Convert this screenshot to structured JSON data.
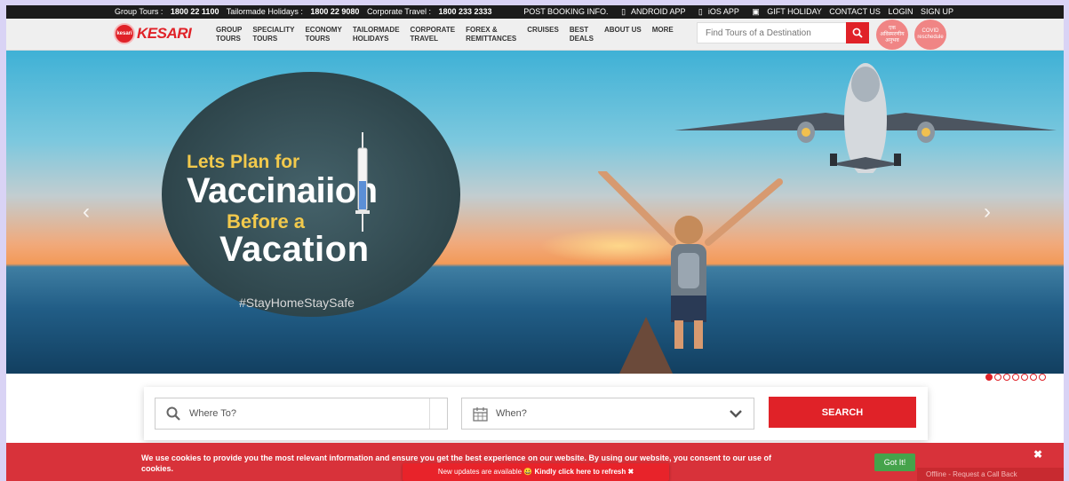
{
  "topbar": {
    "group_tours_label": "Group Tours :",
    "group_tours_phone": "1800 22 1100",
    "tailormade_label": "Tailormade Holidays :",
    "tailormade_phone": "1800 22 9080",
    "corporate_label": "Corporate Travel :",
    "corporate_phone": "1800 233 2333",
    "links": [
      "POST BOOKING INFO.",
      "ANDROID APP",
      "iOS APP",
      "GIFT HOLIDAY",
      "CONTACT US",
      "LOGIN",
      "SIGN UP"
    ]
  },
  "nav": {
    "logo_text": "KESARI",
    "logo_badge": "kesari",
    "menu": [
      "GROUP\nTOURS",
      "SPECIALITY\nTOURS",
      "ECONOMY\nTOURS",
      "TAILORMADE\nHOLIDAYS",
      "CORPORATE\nTRAVEL",
      "FOREX &\nREMITTANCES",
      "CRUISES",
      "BEST\nDEALS",
      "ABOUT US",
      "MORE"
    ],
    "search_placeholder": "Find Tours of a Destination",
    "badge_1": "एक अविस्मरणीय अनुभव",
    "badge_2": "COVID reschedule"
  },
  "hero": {
    "line1": "Lets Plan for",
    "line2": "Vaccinaiion",
    "line3": "Before a",
    "line4": "Vacation",
    "hashtag": "#StayHomeStaySafe",
    "prev": "‹",
    "next": "›",
    "slide_count": 7,
    "active_slide": 1
  },
  "booking": {
    "where_placeholder": "Where To?",
    "when_placeholder": "When?",
    "search_label": "SEARCH"
  },
  "cookie": {
    "text": "We use cookies to provide you the most relevant information and ensure you get the best experience on our website. By using our website, you consent to our use of cookies.",
    "button": "Got It!",
    "close": "✖"
  },
  "update_bar": {
    "text": "New updates are available",
    "emoji": "😀",
    "action": "Kindly click here to refresh",
    "close": "✖"
  },
  "offline": {
    "text": "Offline - Request a Call Back"
  },
  "colors": {
    "brand_red": "#e02228",
    "topbar": "#1c1c1c",
    "cookie_bar": "#d8323a",
    "gotit_green": "#45a34b"
  }
}
